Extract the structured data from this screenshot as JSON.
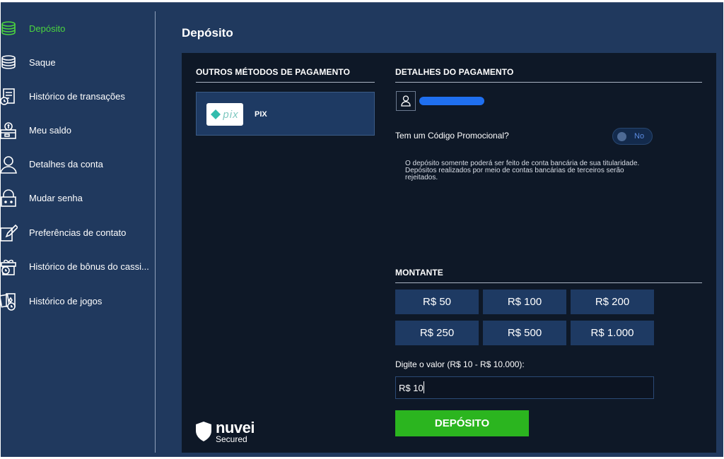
{
  "sidebar": {
    "items": [
      {
        "label": "Depósito",
        "icon": "coins-stack-icon",
        "active": true
      },
      {
        "label": "Saque",
        "icon": "coins-stack-icon",
        "active": false
      },
      {
        "label": "Histórico de transações",
        "icon": "receipt-clock-icon",
        "active": false
      },
      {
        "label": "Meu saldo",
        "icon": "wallet-dollar-icon",
        "active": false
      },
      {
        "label": "Detalhes da conta",
        "icon": "user-icon",
        "active": false
      },
      {
        "label": "Mudar senha",
        "icon": "lock-icon",
        "active": false
      },
      {
        "label": "Preferências de contato",
        "icon": "edit-form-icon",
        "active": false
      },
      {
        "label": "Histórico de bônus do cassi...",
        "icon": "gift-clock-icon",
        "active": false
      },
      {
        "label": "Histórico de jogos",
        "icon": "cards-clock-icon",
        "active": false
      }
    ]
  },
  "main": {
    "title": "Depósito",
    "methods": {
      "title": "OUTROS MÉTODOS DE PAGAMENTO",
      "pix_logo_text": "pix",
      "pix_label": "PIX"
    },
    "details": {
      "title": "DETALHES DO PAGAMENTO",
      "promo_label": "Tem um Código Promocional?",
      "promo_toggle": "No",
      "notice": "O depósito somente poderá ser feito de conta bancária de sua titularidade. Depósitos realizados por meio de contas bancárias de terceiros serão rejeitados."
    },
    "amount": {
      "title": "MONTANTE",
      "options": [
        "R$ 50",
        "R$ 100",
        "R$ 200",
        "R$ 250",
        "R$ 500",
        "R$ 1.000"
      ],
      "input_label": "Digite o valor (R$ 10 - R$ 10.000):",
      "input_value": "R$ 10"
    },
    "deposit_button": "DEPÓSITO",
    "badge": {
      "word": "nuvei",
      "sub": "Secured"
    }
  },
  "colors": {
    "sidebar_bg": "#20395e",
    "panel_bg": "#0e1827",
    "active": "#4bd53e",
    "button": "#1e3a63",
    "deposit": "#2bb51f"
  }
}
